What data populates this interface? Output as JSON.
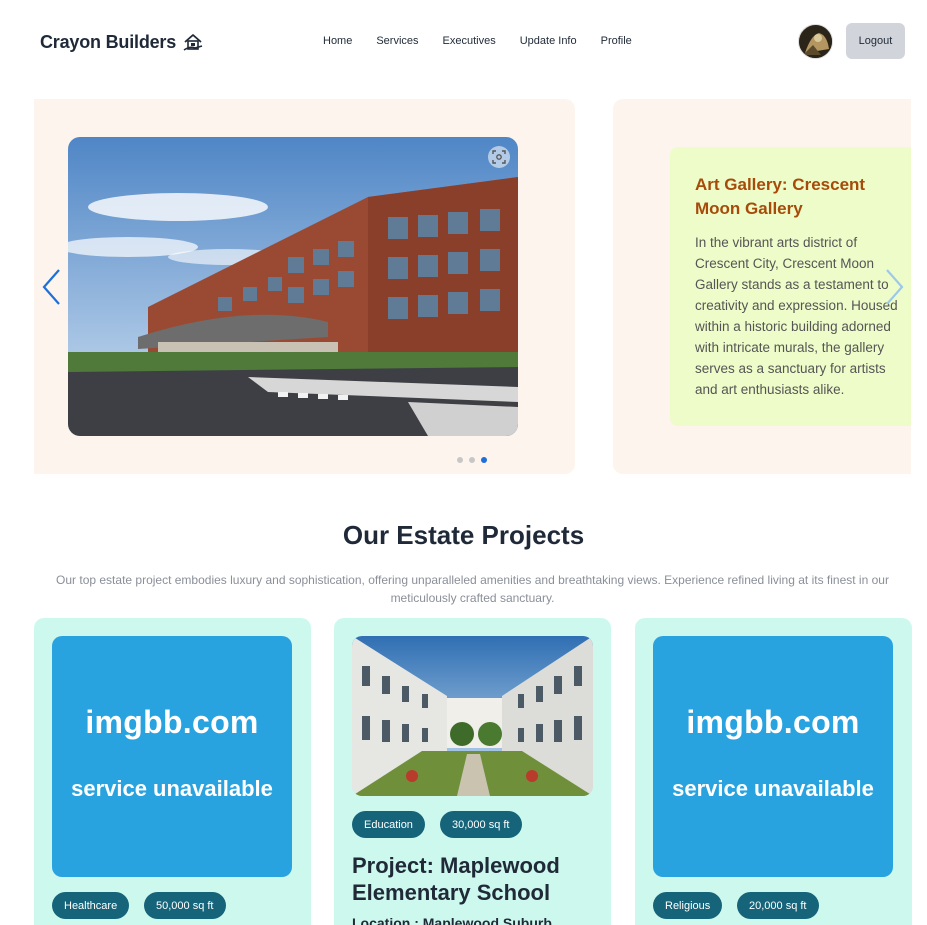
{
  "brand": {
    "name": "Crayon Builders",
    "icon": "house-hand-icon"
  },
  "nav": {
    "items": [
      "Home",
      "Services",
      "Executives",
      "Update Info",
      "Profile"
    ]
  },
  "header": {
    "logout_label": "Logout",
    "avatar_icon": "user-avatar"
  },
  "carousel": {
    "active_index": 3,
    "total": 3,
    "slide": {
      "title": "Art Gallery: Crescent Moon Gallery",
      "description": "In the vibrant arts district of Crescent City, Crescent Moon Gallery stands as a testament to creativity and expression. Housed within a historic building adorned with intricate murals, the gallery serves as a sanctuary for artists and art enthusiasts alike."
    },
    "prev_icon": "chevron-left-icon",
    "next_icon": "chevron-right-icon"
  },
  "section": {
    "title": "Our Estate Projects",
    "subtitle": "Our top estate project embodies luxury and sophistication, offering unparalleled amenities and breathtaking views. Experience refined living at its finest in our meticulously crafted sanctuary."
  },
  "projects": [
    {
      "image_text_1": "imgbb.com",
      "image_text_2": "service unavailable",
      "category": "Healthcare",
      "area": "50,000 sq ft"
    },
    {
      "category": "Education",
      "area": "30,000 sq ft",
      "title": "Project: Maplewood Elementary School",
      "location": "Location : Maplewood Suburb"
    },
    {
      "image_text_1": "imgbb.com",
      "image_text_2": "service unavailable",
      "category": "Religious",
      "area": "20,000 sq ft"
    }
  ],
  "colors": {
    "slide_bg": "#fdf5ed",
    "gallery_box_bg": "#eefcc9",
    "gallery_title": "#a64b0a",
    "card_bg": "#cdf8ee",
    "pill_bg": "#16647a",
    "dot_active": "#1e6fd9"
  }
}
